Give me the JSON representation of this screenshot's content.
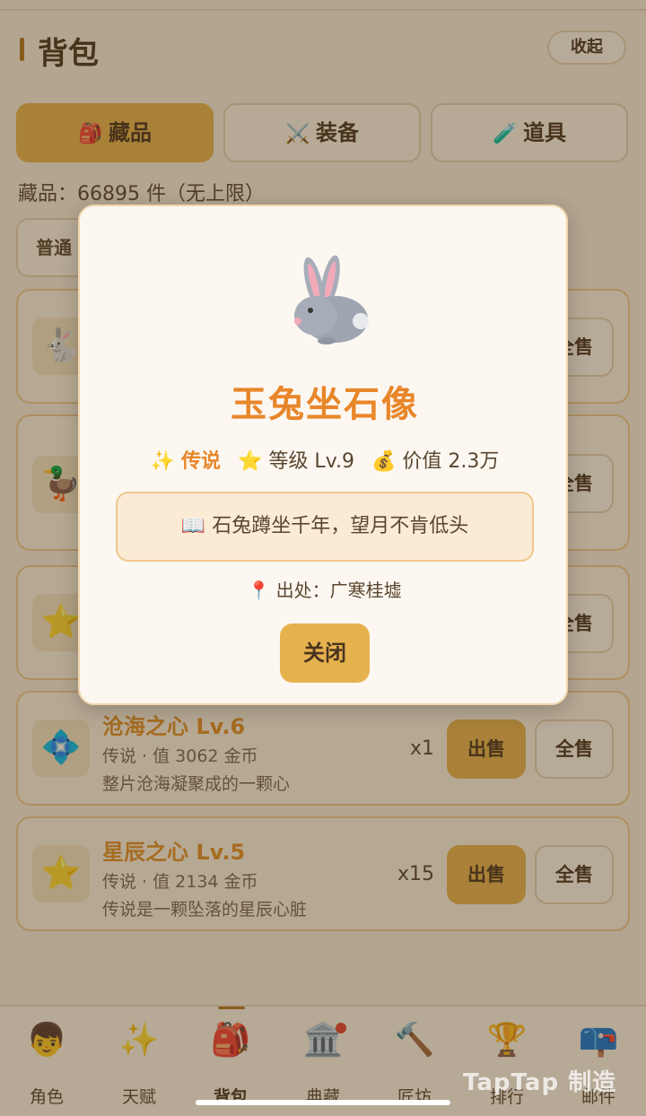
{
  "header": {
    "title": "背包",
    "collapse_label": "收起"
  },
  "tabs": [
    {
      "icon": "🎒",
      "icon_name": "backpack-icon",
      "label": "藏品"
    },
    {
      "icon": "⚔️",
      "icon_name": "crossed-swords-icon",
      "label": "装备"
    },
    {
      "icon": "🧪",
      "icon_name": "test-tube-icon",
      "label": "道具"
    }
  ],
  "collection_count": "藏品：66895 件（无上限）",
  "filter_label": "普通",
  "items": [
    {
      "icon": "🐇",
      "icon_name": "rabbit-icon",
      "name": "",
      "meta": "",
      "desc": "",
      "qty": "",
      "sell": "",
      "sell_all": "全售"
    },
    {
      "icon": "🦆",
      "icon_name": "duck-icon",
      "name": "",
      "meta": "",
      "desc": "",
      "qty": "",
      "sell": "",
      "sell_all": "全售"
    },
    {
      "icon": "⭐",
      "icon_name": "star-icon",
      "name": "",
      "meta": "",
      "desc": "",
      "qty": "",
      "sell": "",
      "sell_all": "全售"
    },
    {
      "icon": "💠",
      "icon_name": "diamond-icon",
      "name": "沧海之心 Lv.6",
      "meta": "传说 · 值 3062 金币",
      "desc": "整片沧海凝聚成的一颗心",
      "qty": "x1",
      "sell": "出售",
      "sell_all": "全售"
    },
    {
      "icon": "⭐",
      "icon_name": "star-icon",
      "name": "星辰之心 Lv.5",
      "meta": "传说 · 值 2134 金币",
      "desc": "传说是一颗坠落的星辰心脏",
      "qty": "x15",
      "sell": "出售",
      "sell_all": "全售"
    }
  ],
  "nav": [
    {
      "icon": "👦",
      "icon_name": "character-icon",
      "label": "角色"
    },
    {
      "icon": "✨",
      "icon_name": "sparkles-icon",
      "label": "天赋"
    },
    {
      "icon": "🎒",
      "icon_name": "backpack-icon",
      "label": "背包"
    },
    {
      "icon": "🏛️",
      "icon_name": "museum-icon",
      "label": "典藏"
    },
    {
      "icon": "🔨",
      "icon_name": "hammer-icon",
      "label": "匠坊"
    },
    {
      "icon": "🏆",
      "icon_name": "trophy-icon",
      "label": "排行"
    },
    {
      "icon": "📪",
      "icon_name": "mailbox-icon",
      "label": "邮件"
    }
  ],
  "watermark": "TapTap 制造",
  "modal": {
    "title": "玉兔坐石像",
    "rarity_icon": "✨",
    "rarity": "传说",
    "level_icon": "⭐",
    "level": "等级 Lv.9",
    "value_icon": "💰",
    "value": "价值 2.3万",
    "quote_icon": "📖",
    "quote": "石兔蹲坐千年，望月不肯低头",
    "origin_icon": "📍",
    "origin": "出处：广寒桂墟",
    "close_label": "关闭"
  },
  "colors": {
    "accent": "#e6b24e",
    "title_orange": "#e8862a",
    "background": "#f6ecdc"
  }
}
